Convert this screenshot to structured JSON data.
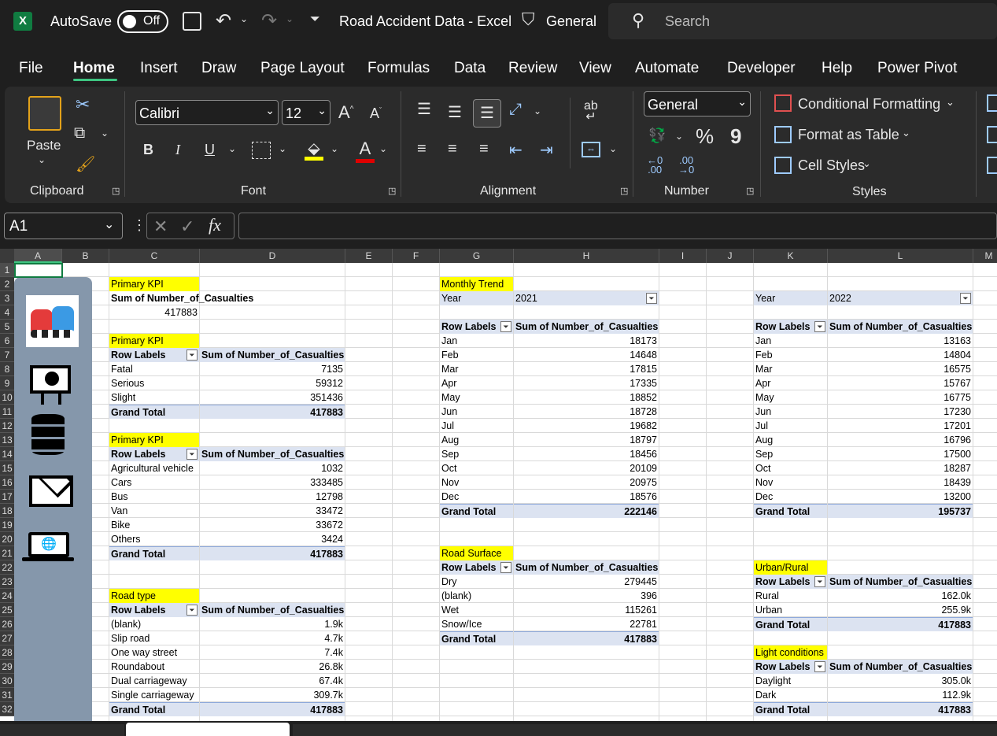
{
  "titlebar": {
    "autosave_label": "AutoSave",
    "toggle_state": "Off",
    "doc_title": "Road Accident Data  -  Excel",
    "sensitivity": "General",
    "search_placeholder": "Search"
  },
  "menu": [
    "File",
    "Home",
    "Insert",
    "Draw",
    "Page Layout",
    "Formulas",
    "Data",
    "Review",
    "View",
    "Automate",
    "Developer",
    "Help",
    "Power Pivot"
  ],
  "ribbon": {
    "paste_label": "Paste",
    "clipboard_label": "Clipboard",
    "font_name": "Calibri",
    "font_size": "12",
    "font_label": "Font",
    "alignment_label": "Alignment",
    "number_format": "General",
    "number_label": "Number",
    "conditional_formatting": "Conditional Formatting",
    "format_as_table": "Format as Table",
    "cell_styles": "Cell Styles",
    "styles_label": "Styles",
    "bold": "B",
    "italic": "I",
    "underline": "U",
    "font_color": "A",
    "percent": "%",
    "comma": "9"
  },
  "formula_bar": {
    "name_box": "A1",
    "fx": "fx",
    "value": ""
  },
  "columns": [
    "A",
    "B",
    "C",
    "D",
    "E",
    "F",
    "G",
    "H",
    "I",
    "J",
    "K",
    "L",
    "M"
  ],
  "rows": [
    "1",
    "2",
    "3",
    "4",
    "5",
    "6",
    "7",
    "8",
    "9",
    "10",
    "11",
    "12",
    "13",
    "14",
    "15",
    "16",
    "17",
    "18",
    "19",
    "20",
    "21",
    "22",
    "23",
    "24",
    "25",
    "26",
    "27",
    "28",
    "29",
    "30",
    "31",
    "32"
  ],
  "pivots": {
    "kpi_total": {
      "title": "Primary KPI",
      "header": "Sum of Number_of_Casualties",
      "value": "417883"
    },
    "severity": {
      "title": "Primary KPI",
      "col1": "Row Labels",
      "col2": "Sum of Number_of_Casualties",
      "rows": [
        [
          "Fatal",
          "7135"
        ],
        [
          "Serious",
          "59312"
        ],
        [
          "Slight",
          "351436"
        ]
      ],
      "total_label": "Grand Total",
      "total": "417883"
    },
    "vehicle": {
      "title": "Primary KPI",
      "col1": "Row Labels",
      "col2": "Sum of Number_of_Casualties",
      "rows": [
        [
          "Agricultural vehicle",
          "1032"
        ],
        [
          "Cars",
          "333485"
        ],
        [
          "Bus",
          "12798"
        ],
        [
          "Van",
          "33472"
        ],
        [
          "Bike",
          "33672"
        ],
        [
          "Others",
          "3424"
        ]
      ],
      "total_label": "Grand Total",
      "total": "417883"
    },
    "road_type": {
      "title": "Road type",
      "col1": "Row Labels",
      "col2": "Sum of Number_of_Casualties",
      "rows": [
        [
          "(blank)",
          "1.9k"
        ],
        [
          "Slip road",
          "4.7k"
        ],
        [
          "One way street",
          "7.4k"
        ],
        [
          "Roundabout",
          "26.8k"
        ],
        [
          "Dual carriageway",
          "67.4k"
        ],
        [
          "Single carriageway",
          "309.7k"
        ]
      ],
      "total_label": "Grand Total",
      "total": "417883"
    },
    "monthly_2021": {
      "title": "Monthly Trend",
      "year_label": "Year",
      "year": "2021",
      "col1": "Row Labels",
      "col2": "Sum of Number_of_Casualties",
      "rows": [
        [
          "Jan",
          "18173"
        ],
        [
          "Feb",
          "14648"
        ],
        [
          "Mar",
          "17815"
        ],
        [
          "Apr",
          "17335"
        ],
        [
          "May",
          "18852"
        ],
        [
          "Jun",
          "18728"
        ],
        [
          "Jul",
          "19682"
        ],
        [
          "Aug",
          "18797"
        ],
        [
          "Sep",
          "18456"
        ],
        [
          "Oct",
          "20109"
        ],
        [
          "Nov",
          "20975"
        ],
        [
          "Dec",
          "18576"
        ]
      ],
      "total_label": "Grand Total",
      "total": "222146"
    },
    "monthly_2022": {
      "year_label": "Year",
      "year": "2022",
      "col1": "Row Labels",
      "col2": "Sum of Number_of_Casualties",
      "rows": [
        [
          "Jan",
          "13163"
        ],
        [
          "Feb",
          "14804"
        ],
        [
          "Mar",
          "16575"
        ],
        [
          "Apr",
          "15767"
        ],
        [
          "May",
          "16775"
        ],
        [
          "Jun",
          "17230"
        ],
        [
          "Jul",
          "17201"
        ],
        [
          "Aug",
          "16796"
        ],
        [
          "Sep",
          "17500"
        ],
        [
          "Oct",
          "18287"
        ],
        [
          "Nov",
          "18439"
        ],
        [
          "Dec",
          "13200"
        ]
      ],
      "total_label": "Grand Total",
      "total": "195737"
    },
    "road_surface": {
      "title": "Road Surface",
      "col1": "Row Labels",
      "col2": "Sum of Number_of_Casualties",
      "rows": [
        [
          "Dry",
          "279445"
        ],
        [
          "(blank)",
          "396"
        ],
        [
          "Wet",
          "115261"
        ],
        [
          "Snow/Ice",
          "22781"
        ]
      ],
      "total_label": "Grand Total",
      "total": "417883"
    },
    "urban_rural": {
      "title": "Urban/Rural",
      "col1": "Row Labels",
      "col2": "Sum of Number_of_Casualties",
      "rows": [
        [
          "Rural",
          "162.0k"
        ],
        [
          "Urban",
          "255.9k"
        ]
      ],
      "total_label": "Grand Total",
      "total": "417883"
    },
    "light": {
      "title": "Light conditions",
      "col1": "Row Labels",
      "col2": "Sum of Number_of_Casualties",
      "rows": [
        [
          "Daylight",
          "305.0k"
        ],
        [
          "Dark",
          "112.9k"
        ]
      ],
      "total_label": "Grand Total",
      "total": "417883"
    }
  },
  "colors": {
    "excel_green": "#107c41",
    "kpi_highlight": "#ffff00",
    "pivot_header": "#dce3f1",
    "sidebar": "#8597ab"
  }
}
